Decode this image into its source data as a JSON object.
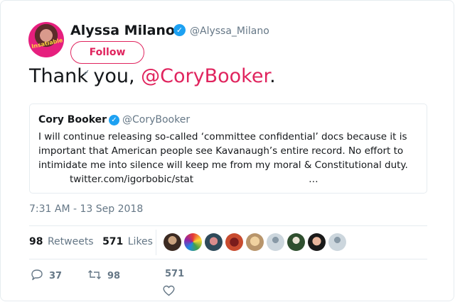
{
  "author": {
    "name": "Alyssa Milano",
    "handle": "@Alyssa_Milano",
    "avatar_text": "Insatiable",
    "verified": true
  },
  "follow_label": "Follow",
  "tweet": {
    "text_before": "Thank",
    "text_middle": " you, ",
    "mention": "@CoryBooker",
    "text_after": "."
  },
  "quoted": {
    "name": "Cory Booker",
    "handle": "@CoryBooker",
    "verified": true,
    "body": "I will continue releasing so-called ‘committee confidential’ docs because it is important that American people see Kavanaugh’s entire record. No effort to intimidate me into silence will keep me from my moral & Constitutional duty.",
    "link": "twitter.com/igorbobic/stat",
    "ellipsis": "…"
  },
  "timestamp": "7:31 AM - 13 Sep 2018",
  "stats": {
    "retweets_count": "98",
    "retweets_label": "Retweets",
    "likes_count": "571",
    "likes_label": "Likes"
  },
  "actions": {
    "replies": "37",
    "retweets": "98",
    "likes": "571"
  },
  "colors": {
    "accent": "#e0245e",
    "verified": "#1da1f2",
    "muted": "#657786"
  }
}
